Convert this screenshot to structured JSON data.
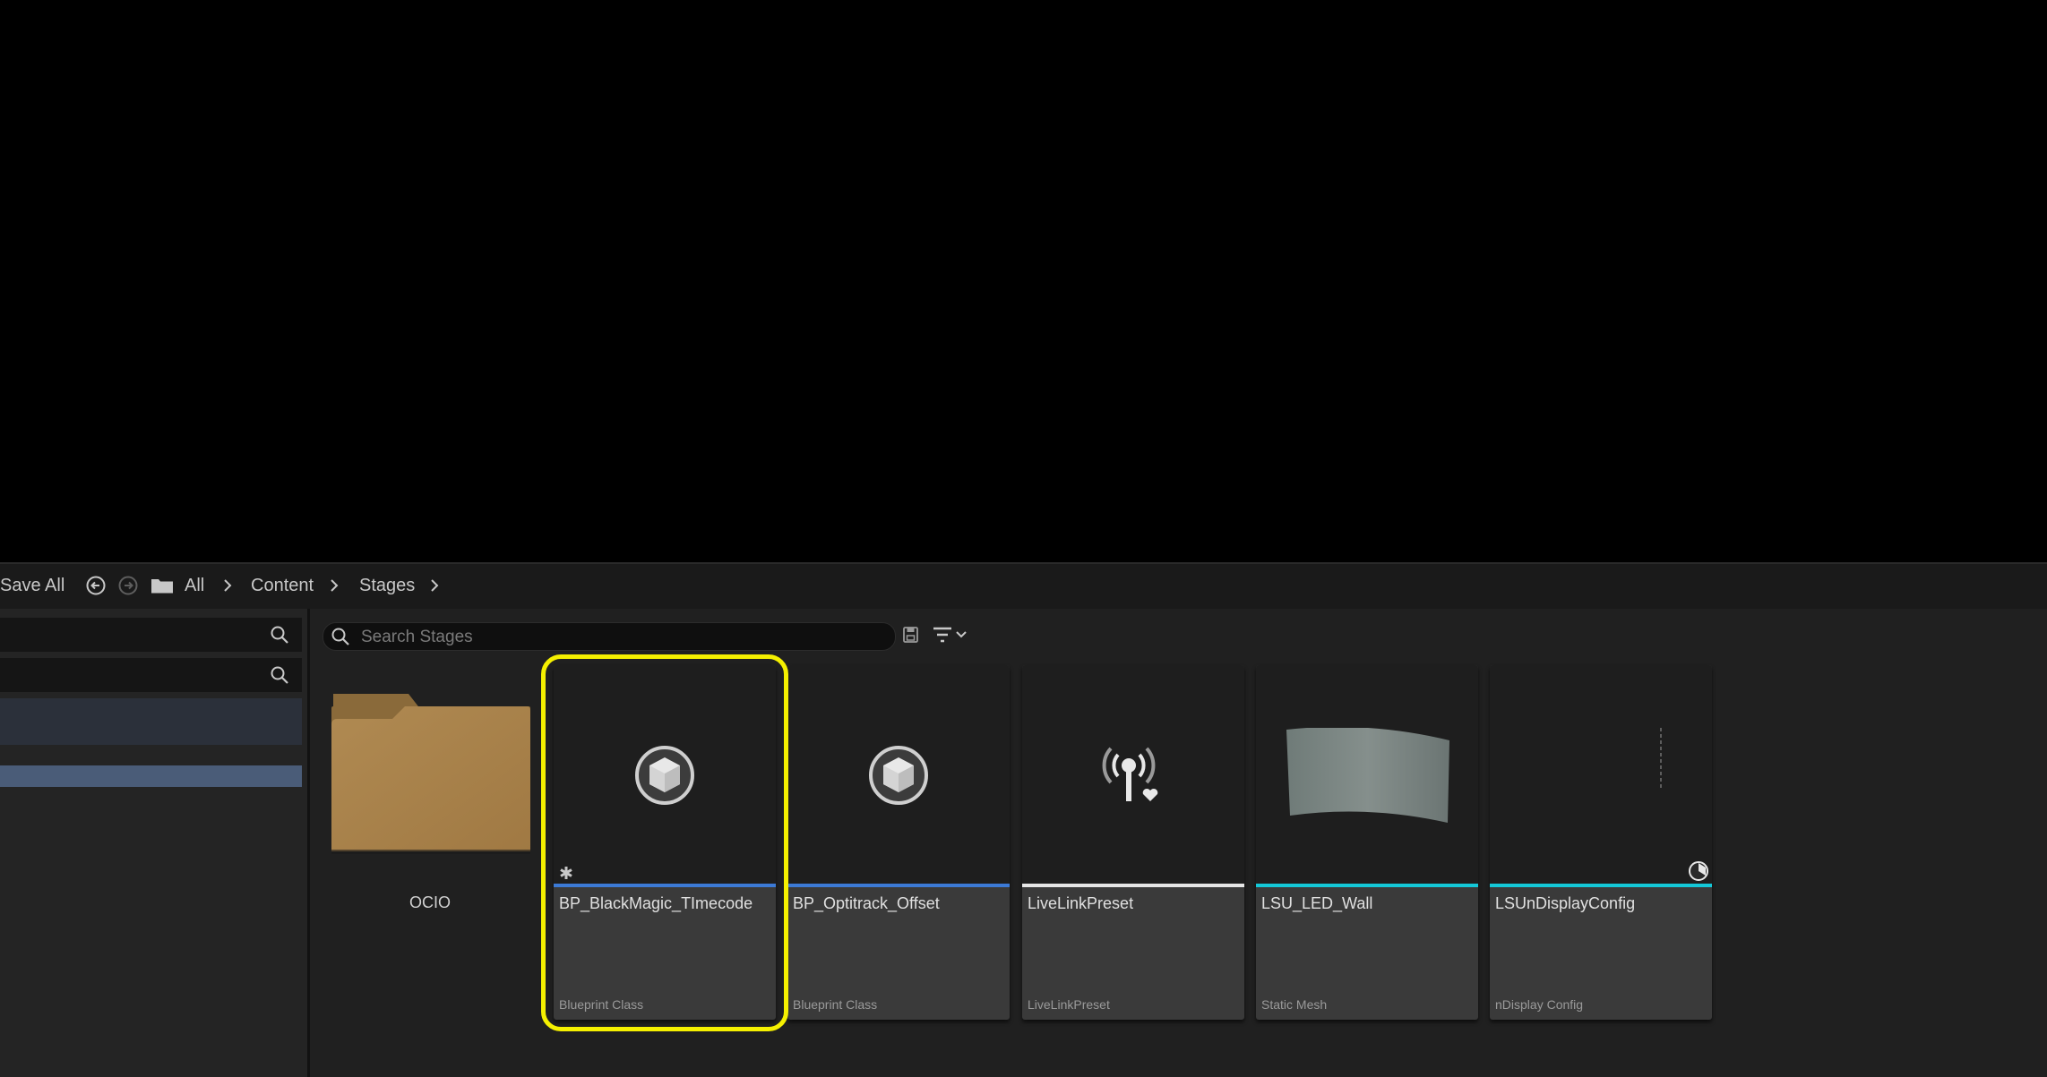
{
  "toolbar": {
    "save_all_label": "Save All",
    "breadcrumb": [
      "All",
      "Content",
      "Stages"
    ]
  },
  "search": {
    "placeholder": "Search Stages"
  },
  "folders": [
    {
      "name": "OCIO",
      "icon": "folder-icon",
      "color": "#a9824b"
    }
  ],
  "assets": [
    {
      "name": "BP_BlackMagic_TImecode",
      "type": "Blueprint Class",
      "icon": "blueprint-cube-icon",
      "bar_color": "#3c7ad6"
    },
    {
      "name": "BP_Optitrack_Offset",
      "type": "Blueprint Class",
      "icon": "blueprint-cube-icon",
      "bar_color": "#3c7ad6"
    },
    {
      "name": "LiveLinkPreset",
      "type": "LiveLinkPreset",
      "icon": "livelink-broadcast-icon",
      "bar_color": "#e6e6e6"
    },
    {
      "name": "LSU_LED_Wall",
      "type": "Static Mesh",
      "icon": "led-wall-mesh-thumbnail",
      "bar_color": "#14c8d8"
    },
    {
      "name": "LSUnDisplayConfig",
      "type": "nDisplay Config",
      "icon": "ndisplay-config-thumbnail",
      "bar_color": "#14c8d8"
    }
  ],
  "highlight_color": "#f5f000"
}
